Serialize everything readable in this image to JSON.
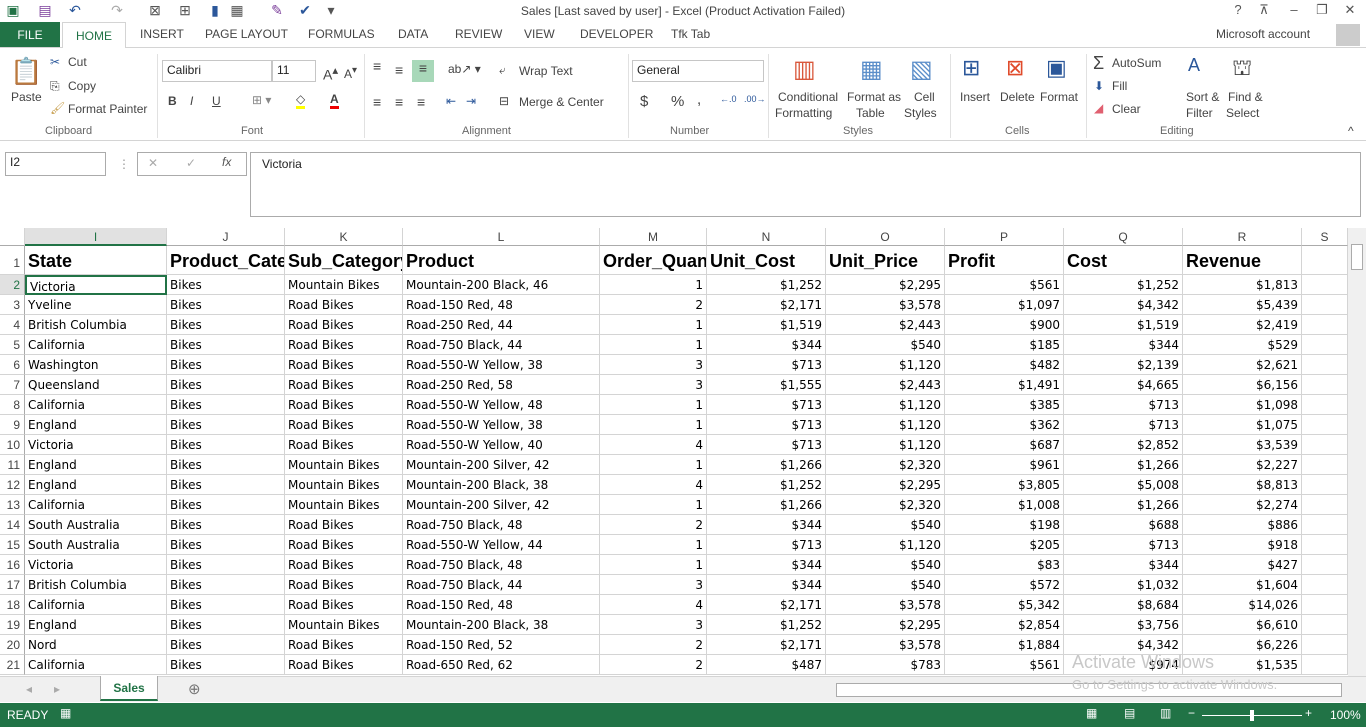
{
  "app": {
    "title": "Sales [Last saved by user] - Excel (Product Activation Failed)",
    "account": "Microsoft account"
  },
  "colors": {
    "accent": "#217346",
    "grid": "#d4d4d4"
  },
  "tabs": [
    "FILE",
    "HOME",
    "INSERT",
    "PAGE LAYOUT",
    "FORMULAS",
    "DATA",
    "REVIEW",
    "VIEW",
    "DEVELOPER",
    "Tfk Tab"
  ],
  "ribbon": {
    "clipboard": {
      "paste": "Paste",
      "cut": "Cut",
      "copy": "Copy",
      "format_painter": "Format Painter",
      "label": "Clipboard"
    },
    "font": {
      "name": "Calibri",
      "size": "11",
      "bold": "B",
      "italic": "I",
      "underline": "U",
      "label": "Font"
    },
    "alignment": {
      "wrap": "Wrap Text",
      "merge": "Merge & Center",
      "label": "Alignment"
    },
    "number": {
      "format": "General",
      "currency": "$",
      "percent": "%",
      "comma": ",",
      "label": "Number"
    },
    "styles": {
      "conditional": "Conditional",
      "conditional2": "Formatting",
      "format_table": "Format as",
      "format_table2": "Table",
      "cell_styles": "Cell",
      "cell_styles2": "Styles",
      "label": "Styles"
    },
    "cells": {
      "insert": "Insert",
      "delete": "Delete",
      "format": "Format",
      "label": "Cells"
    },
    "editing": {
      "autosum": "AutoSum",
      "fill": "Fill",
      "clear": "Clear",
      "sort": "Sort &",
      "sort2": "Filter",
      "find": "Find &",
      "find2": "Select",
      "label": "Editing"
    }
  },
  "formula_bar": {
    "name_box": "I2",
    "fx": "fx",
    "value": "Victoria"
  },
  "columns": [
    "I",
    "J",
    "K",
    "L",
    "M",
    "N",
    "O",
    "P",
    "Q",
    "R",
    "S"
  ],
  "headers": [
    "State",
    "Product_Category",
    "Sub_Category",
    "Product",
    "Order_Quantity",
    "Unit_Cost",
    "Unit_Price",
    "Profit",
    "Cost",
    "Revenue"
  ],
  "rows": [
    [
      "Victoria",
      "Bikes",
      "Mountain Bikes",
      "Mountain-200 Black, 46",
      "1",
      "$1,252",
      "$2,295",
      "$561",
      "$1,252",
      "$1,813"
    ],
    [
      "Yveline",
      "Bikes",
      "Road Bikes",
      "Road-150 Red, 48",
      "2",
      "$2,171",
      "$3,578",
      "$1,097",
      "$4,342",
      "$5,439"
    ],
    [
      "British Columbia",
      "Bikes",
      "Road Bikes",
      "Road-250 Red, 44",
      "1",
      "$1,519",
      "$2,443",
      "$900",
      "$1,519",
      "$2,419"
    ],
    [
      "California",
      "Bikes",
      "Road Bikes",
      "Road-750 Black, 44",
      "1",
      "$344",
      "$540",
      "$185",
      "$344",
      "$529"
    ],
    [
      "Washington",
      "Bikes",
      "Road Bikes",
      "Road-550-W Yellow, 38",
      "3",
      "$713",
      "$1,120",
      "$482",
      "$2,139",
      "$2,621"
    ],
    [
      "Queensland",
      "Bikes",
      "Road Bikes",
      "Road-250 Red, 58",
      "3",
      "$1,555",
      "$2,443",
      "$1,491",
      "$4,665",
      "$6,156"
    ],
    [
      "California",
      "Bikes",
      "Road Bikes",
      "Road-550-W Yellow, 48",
      "1",
      "$713",
      "$1,120",
      "$385",
      "$713",
      "$1,098"
    ],
    [
      "England",
      "Bikes",
      "Road Bikes",
      "Road-550-W Yellow, 38",
      "1",
      "$713",
      "$1,120",
      "$362",
      "$713",
      "$1,075"
    ],
    [
      "Victoria",
      "Bikes",
      "Road Bikes",
      "Road-550-W Yellow, 40",
      "4",
      "$713",
      "$1,120",
      "$687",
      "$2,852",
      "$3,539"
    ],
    [
      "England",
      "Bikes",
      "Mountain Bikes",
      "Mountain-200 Silver, 42",
      "1",
      "$1,266",
      "$2,320",
      "$961",
      "$1,266",
      "$2,227"
    ],
    [
      "England",
      "Bikes",
      "Mountain Bikes",
      "Mountain-200 Black, 38",
      "4",
      "$1,252",
      "$2,295",
      "$3,805",
      "$5,008",
      "$8,813"
    ],
    [
      "California",
      "Bikes",
      "Mountain Bikes",
      "Mountain-200 Silver, 42",
      "1",
      "$1,266",
      "$2,320",
      "$1,008",
      "$1,266",
      "$2,274"
    ],
    [
      "South Australia",
      "Bikes",
      "Road Bikes",
      "Road-750 Black, 48",
      "2",
      "$344",
      "$540",
      "$198",
      "$688",
      "$886"
    ],
    [
      "South Australia",
      "Bikes",
      "Road Bikes",
      "Road-550-W Yellow, 44",
      "1",
      "$713",
      "$1,120",
      "$205",
      "$713",
      "$918"
    ],
    [
      "Victoria",
      "Bikes",
      "Road Bikes",
      "Road-750 Black, 48",
      "1",
      "$344",
      "$540",
      "$83",
      "$344",
      "$427"
    ],
    [
      "British Columbia",
      "Bikes",
      "Road Bikes",
      "Road-750 Black, 44",
      "3",
      "$344",
      "$540",
      "$572",
      "$1,032",
      "$1,604"
    ],
    [
      "California",
      "Bikes",
      "Road Bikes",
      "Road-150 Red, 48",
      "4",
      "$2,171",
      "$3,578",
      "$5,342",
      "$8,684",
      "$14,026"
    ],
    [
      "England",
      "Bikes",
      "Mountain Bikes",
      "Mountain-200 Black, 38",
      "3",
      "$1,252",
      "$2,295",
      "$2,854",
      "$3,756",
      "$6,610"
    ],
    [
      "Nord",
      "Bikes",
      "Road Bikes",
      "Road-150 Red, 52",
      "2",
      "$2,171",
      "$3,578",
      "$1,884",
      "$4,342",
      "$6,226"
    ],
    [
      "California",
      "Bikes",
      "Road Bikes",
      "Road-650 Red, 62",
      "2",
      "$487",
      "$783",
      "$561",
      "$974",
      "$1,535"
    ]
  ],
  "sheet_tab": "Sales",
  "watermark": {
    "line1": "Activate Windows",
    "line2": "Go to Settings to activate Windows."
  },
  "status": {
    "ready": "READY",
    "zoom": "100%"
  }
}
